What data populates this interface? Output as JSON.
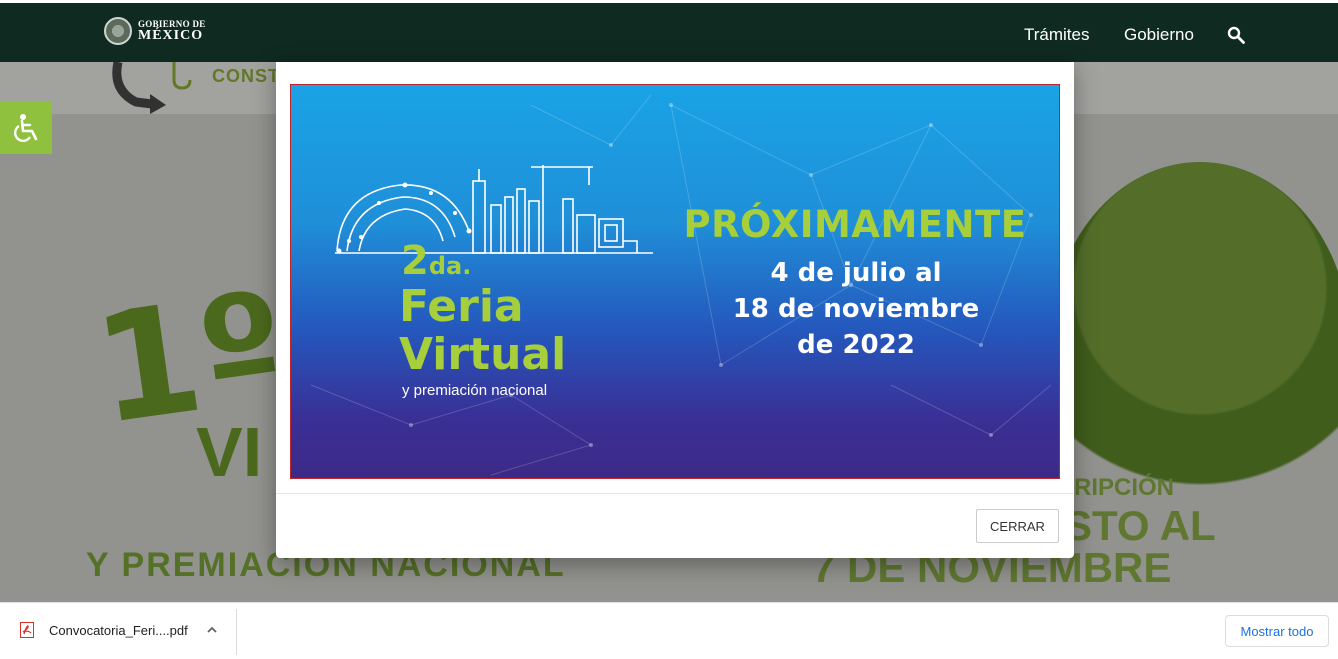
{
  "header": {
    "logo_line1": "GOBIERNO DE",
    "logo_line2": "MÉXICO",
    "nav": [
      "Trámites",
      "Gobierno"
    ]
  },
  "background": {
    "const_text": "CONST",
    "big_number": "1º",
    "vi_text": "VI",
    "premiacion": "Y PREMIACIÓN NACIONAL",
    "inscripcion": "RIPCIÓN",
    "to_al": "STO AL",
    "noviembre": "7 DE NOVIEMBRE"
  },
  "modal": {
    "banner": {
      "ordinal": "2",
      "ordinal_suffix": "da.",
      "title_line1": "Feria",
      "title_line2": "Virtual",
      "subtitle": "y premiación nacional",
      "headline": "PRÓXIMAMENTE",
      "date_line1": "4 de julio al",
      "date_line2": "18 de noviembre",
      "date_line3": "de 2022"
    },
    "close_label": "CERRAR"
  },
  "download_bar": {
    "file_name": "Convocatoria_Feri....pdf",
    "show_all_label": "Mostrar todo"
  },
  "colors": {
    "navbar": "#0f2a20",
    "accent_green": "#a6cf3b",
    "access_button": "#8fc13f",
    "link_blue": "#1a73e8"
  }
}
